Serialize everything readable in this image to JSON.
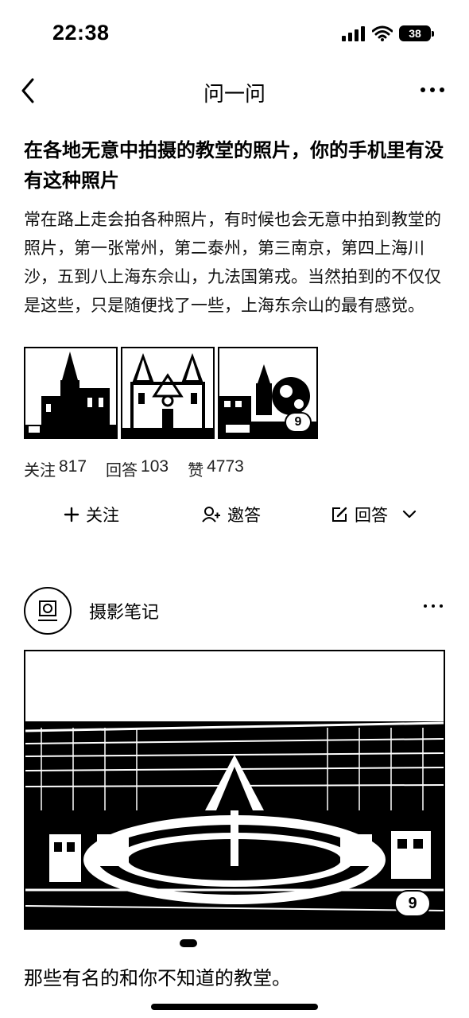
{
  "status_bar": {
    "time": "22:38",
    "battery": "38"
  },
  "nav": {
    "title": "问一问"
  },
  "question": {
    "title": "在各地无意中拍摄的教堂的照片，你的手机里有没有这种照片",
    "body": "常在路上走会拍各种照片，有时候也会无意中拍到教堂的照片，第一张常州，第二泰州，第三南京，第四上海川沙，五到八上海东佘山，九法国第戎。当然拍到的不仅仅是这些，只是随便找了一些，上海东佘山的最有感觉。",
    "image_count": "9"
  },
  "stats": {
    "follow_label": "关注",
    "follow_count": "817",
    "answer_label": "回答",
    "answer_count": "103",
    "like_label": "赞",
    "like_count": "4773"
  },
  "actions": {
    "follow": "关注",
    "invite": "邀答",
    "answer": "回答"
  },
  "answer": {
    "author": "摄影笔记",
    "image_count": "9",
    "text": "那些有名的和你不知道的教堂。"
  },
  "icons": {
    "back": "chevron-left-icon",
    "more": "more-horizontal-icon",
    "plus": "plus-icon",
    "invite": "user-invite-icon",
    "edit": "edit-icon",
    "chevron": "chevron-down-icon",
    "signal": "signal-icon",
    "wifi": "wifi-icon",
    "battery": "battery-icon"
  }
}
